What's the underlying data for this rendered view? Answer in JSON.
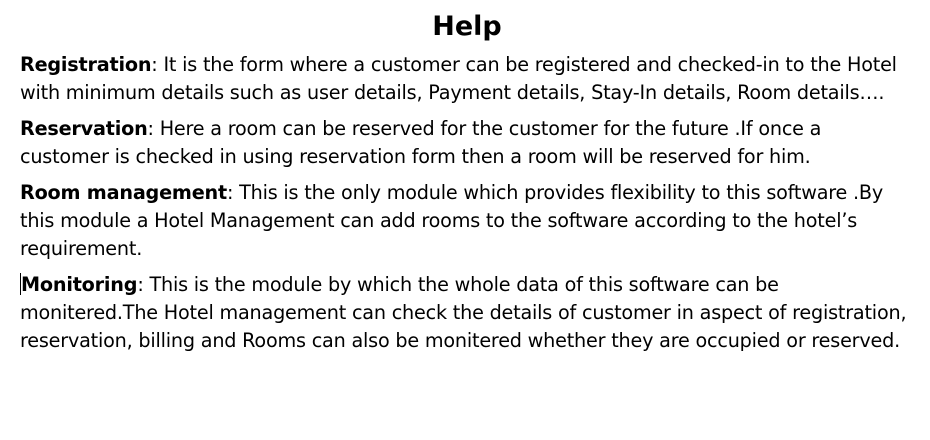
{
  "title": "Help",
  "sections": [
    {
      "term": "Registration",
      "text": ": It is the form where a customer can be registered and checked-in to the Hotel with minimum details such as user details, Payment details, Stay-In details, Room details…."
    },
    {
      "term": "Reservation",
      "text": ": Here a room can be reserved for the customer for the future .If once a customer is checked in using reservation form then a room will be reserved for him."
    },
    {
      "term": "Room management",
      "text": ": This is the only module which provides flexibility to this software .By this module a Hotel Management can add rooms to the software according to the hotel’s requirement."
    },
    {
      "term": "Monitoring",
      "text": ": This is the module by which the whole data of this software can be monitered.The Hotel management can check the details of customer in aspect of registration, reservation, billing and Rooms can also be monitered whether they are occupied or reserved."
    }
  ]
}
